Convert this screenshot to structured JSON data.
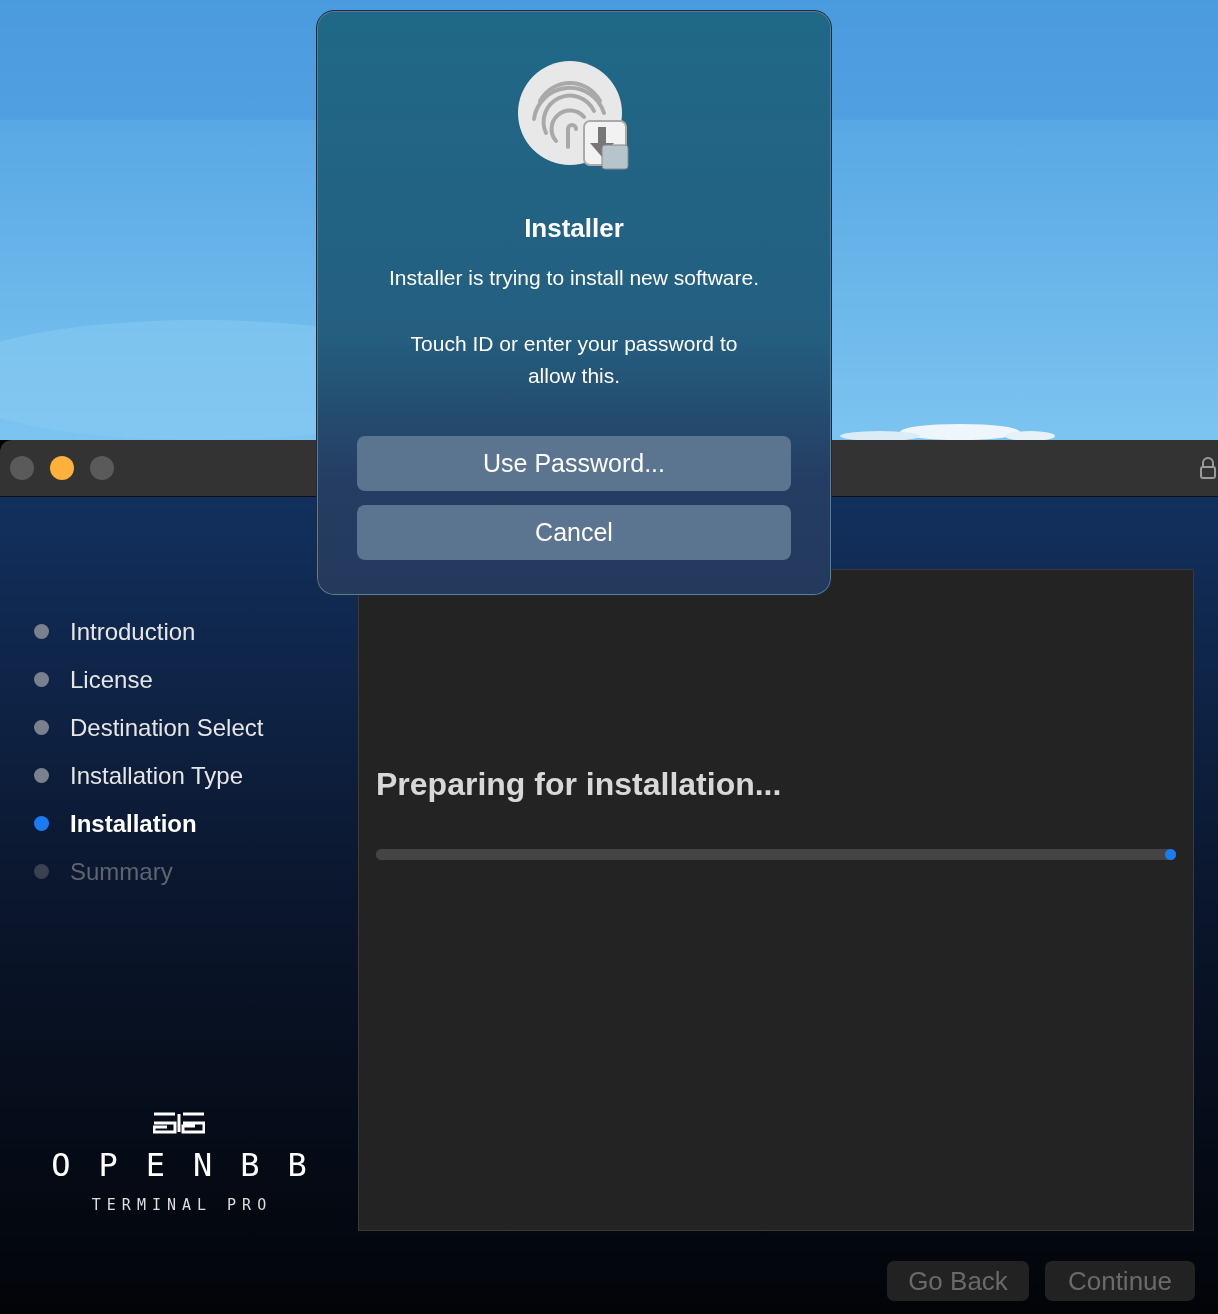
{
  "window": {
    "traffic_lights": [
      {
        "color": "#5a5a5a"
      },
      {
        "color": "#feb13a"
      },
      {
        "color": "#5a5a5a"
      }
    ]
  },
  "sidebar": {
    "steps": [
      {
        "label": "Introduction",
        "selected": false,
        "disabled": false
      },
      {
        "label": "License",
        "selected": false,
        "disabled": false
      },
      {
        "label": "Destination Select",
        "selected": false,
        "disabled": false
      },
      {
        "label": "Installation Type",
        "selected": false,
        "disabled": false
      },
      {
        "label": "Installation",
        "selected": true,
        "disabled": false
      },
      {
        "label": "Summary",
        "selected": false,
        "disabled": true
      }
    ],
    "logo": {
      "name": "OPENBB",
      "subtitle": "TERMINAL PRO"
    }
  },
  "main": {
    "heading": "Preparing for installation...",
    "progress": {
      "level": 1
    }
  },
  "buttons": [
    {
      "label": "Go Back",
      "disabled": true
    },
    {
      "label": "Continue",
      "disabled": true
    }
  ],
  "dialog": {
    "title": "Installer",
    "message": "Installer is trying to install new software.",
    "prompt": "Touch ID or enter your password to allow this.",
    "buttons": [
      "Use Password...",
      "Cancel"
    ]
  }
}
